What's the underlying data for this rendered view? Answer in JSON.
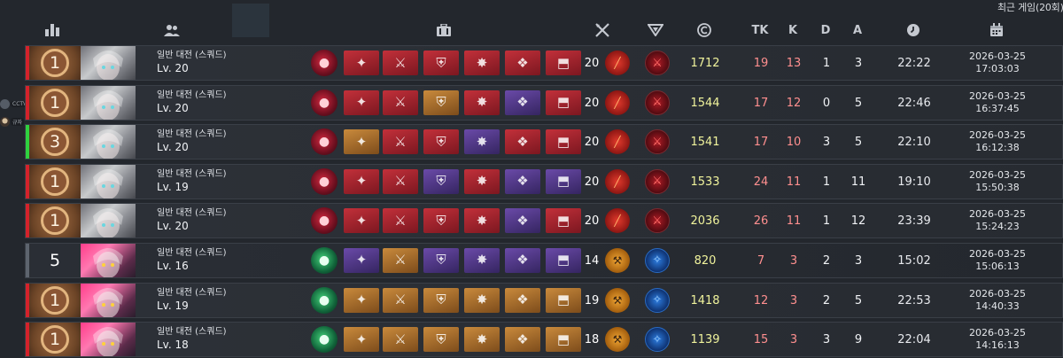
{
  "title": "최근 게임(20회)",
  "colors": {
    "win_accent": "#d4222b",
    "loss_accent": "#5d646e",
    "third_accent": "#2fd13f",
    "credits": "#f0f39c",
    "kills": "#ff8f8f"
  },
  "side": {
    "chip1_label": "CCTV-NA",
    "chip2_label": "규자"
  },
  "header": {
    "icons": [
      "rank-icon",
      "players-icon",
      "equipment-icon",
      "weapon-icon",
      "emblem-icon",
      "credit-icon"
    ],
    "tk_label": "TK",
    "k_label": "K",
    "d_label": "D",
    "a_label": "A",
    "time_icon": "clock-icon",
    "date_icon": "calendar-icon"
  },
  "matches": [
    {
      "rank": "1",
      "result": "win",
      "character": "silver",
      "mode": "일반 대전 (스쿼드)",
      "level": "Lv. 20",
      "class_icon": "crimson",
      "items": [
        "red",
        "red",
        "red",
        "red",
        "red",
        "red"
      ],
      "weapon_level": "20",
      "skill": "blade",
      "emblem": "e-red",
      "credits": "1712",
      "tk": "19",
      "k": "13",
      "d": "1",
      "a": "3",
      "duration": "22:22",
      "date": "2026-03-25",
      "time": "17:03:03"
    },
    {
      "rank": "1",
      "result": "win",
      "character": "silver",
      "mode": "일반 대전 (스쿼드)",
      "level": "Lv. 20",
      "class_icon": "crimson",
      "items": [
        "red",
        "red",
        "orange",
        "red",
        "purple",
        "red"
      ],
      "weapon_level": "20",
      "skill": "blade",
      "emblem": "e-red",
      "credits": "1544",
      "tk": "17",
      "k": "12",
      "d": "0",
      "a": "5",
      "duration": "22:46",
      "date": "2026-03-25",
      "time": "16:37:45"
    },
    {
      "rank": "3",
      "result": "third",
      "character": "silver",
      "mode": "일반 대전 (스쿼드)",
      "level": "Lv. 20",
      "class_icon": "crimson",
      "items": [
        "orange",
        "red",
        "red",
        "purple",
        "red",
        "red"
      ],
      "weapon_level": "20",
      "skill": "blade",
      "emblem": "e-red",
      "credits": "1541",
      "tk": "17",
      "k": "10",
      "d": "3",
      "a": "5",
      "duration": "22:10",
      "date": "2026-03-25",
      "time": "16:12:38"
    },
    {
      "rank": "1",
      "result": "win",
      "character": "silver",
      "mode": "일반 대전 (스쿼드)",
      "level": "Lv. 19",
      "class_icon": "crimson",
      "items": [
        "red",
        "red",
        "purple",
        "red",
        "purple",
        "purple"
      ],
      "weapon_level": "20",
      "skill": "blade",
      "emblem": "e-red",
      "credits": "1533",
      "tk": "24",
      "k": "11",
      "d": "1",
      "a": "11",
      "duration": "19:10",
      "date": "2026-03-25",
      "time": "15:50:38"
    },
    {
      "rank": "1",
      "result": "win",
      "character": "silver",
      "mode": "일반 대전 (스쿼드)",
      "level": "Lv. 20",
      "class_icon": "crimson",
      "items": [
        "red",
        "red",
        "red",
        "red",
        "purple",
        "red"
      ],
      "weapon_level": "20",
      "skill": "blade",
      "emblem": "e-red",
      "credits": "2036",
      "tk": "26",
      "k": "11",
      "d": "1",
      "a": "12",
      "duration": "23:39",
      "date": "2026-03-25",
      "time": "15:24:23"
    },
    {
      "rank": "5",
      "result": "loss",
      "character": "pink",
      "mode": "일반 대전 (스쿼드)",
      "level": "Lv. 16",
      "class_icon": "emerald",
      "items": [
        "purple",
        "orange",
        "purple",
        "purple",
        "purple",
        "purple"
      ],
      "weapon_level": "14",
      "skill": "hammer",
      "emblem": "e-blue",
      "credits": "820",
      "tk": "7",
      "k": "3",
      "d": "2",
      "a": "3",
      "duration": "15:02",
      "date": "2026-03-25",
      "time": "15:06:13"
    },
    {
      "rank": "1",
      "result": "win",
      "character": "pink",
      "mode": "일반 대전 (스쿼드)",
      "level": "Lv. 19",
      "class_icon": "emerald",
      "items": [
        "orange",
        "orange",
        "orange",
        "orange",
        "orange",
        "orange"
      ],
      "weapon_level": "19",
      "skill": "hammer",
      "emblem": "e-blue",
      "credits": "1418",
      "tk": "12",
      "k": "3",
      "d": "2",
      "a": "5",
      "duration": "22:53",
      "date": "2026-03-25",
      "time": "14:40:33"
    },
    {
      "rank": "1",
      "result": "win",
      "character": "pink",
      "mode": "일반 대전 (스쿼드)",
      "level": "Lv. 18",
      "class_icon": "emerald",
      "items": [
        "orange",
        "orange",
        "orange",
        "orange",
        "orange",
        "orange"
      ],
      "weapon_level": "18",
      "skill": "hammer",
      "emblem": "e-blue",
      "credits": "1139",
      "tk": "15",
      "k": "3",
      "d": "3",
      "a": "9",
      "duration": "22:04",
      "date": "2026-03-25",
      "time": "14:16:13"
    }
  ]
}
